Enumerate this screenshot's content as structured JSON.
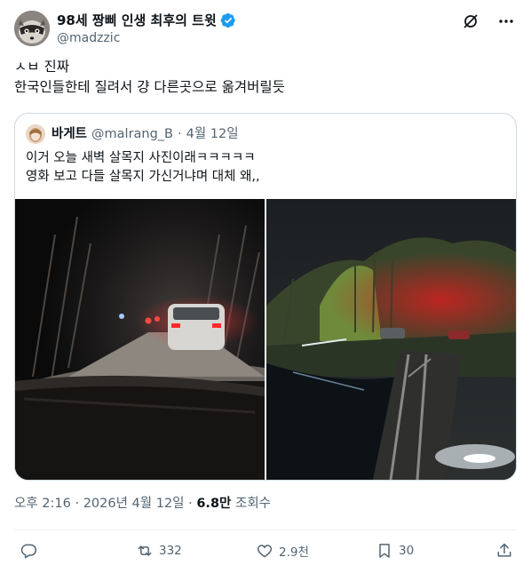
{
  "author": {
    "display_name": "98세 짱삐 인생 최후의 트윗",
    "handle": "@madzzic",
    "avatar_icon": "raccoon-avatar",
    "verified_color": "#1d9bf0"
  },
  "tweet_lines": [
    "ㅅㅂ 진짜",
    "한국인들한테 질려서 걍 다른곳으로 옮겨버릴듯"
  ],
  "quote": {
    "display_name": "바게트",
    "handle": "@malrang_B",
    "separator": "·",
    "date": "4월 12일",
    "lines": [
      "이거 오늘 새벽 살목지 사진이래ㅋㅋㅋㅋㅋ",
      "영화 보고 다들 살목지 가신거냐며 대체 왜,,"
    ],
    "media": [
      {
        "icon": "night-road-photo"
      },
      {
        "icon": "night-reservoir-photo"
      }
    ]
  },
  "meta": {
    "time": "오후 2:16",
    "separator": "·",
    "date": "2026년 4월 12일",
    "views": "6.8만",
    "views_label": "조회수"
  },
  "actions": {
    "reply": {
      "icon": "reply-icon",
      "count": ""
    },
    "retweet": {
      "icon": "retweet-icon",
      "count": "332"
    },
    "like": {
      "icon": "heart-icon",
      "count": "2.9천"
    },
    "bookmark": {
      "icon": "bookmark-icon",
      "count": "30"
    },
    "share": {
      "icon": "share-icon"
    }
  },
  "colors": {
    "text": "#0f1419",
    "muted": "#536471",
    "border": "#cfd9de",
    "accent": "#1d9bf0"
  }
}
